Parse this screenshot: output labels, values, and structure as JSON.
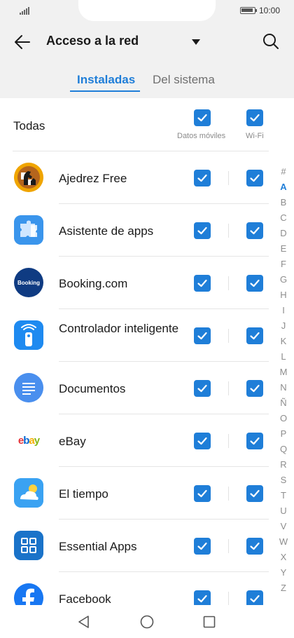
{
  "status": {
    "time": "10:00"
  },
  "header": {
    "title": "Acceso a la red",
    "tabs": [
      {
        "label": "Instaladas",
        "active": true
      },
      {
        "label": "Del sistema",
        "active": false
      }
    ]
  },
  "all_row": {
    "label": "Todas",
    "mobile_label": "Datos móviles",
    "wifi_label": "Wi-Fi",
    "mobile_checked": true,
    "wifi_checked": true
  },
  "apps": [
    {
      "name": "Ajedrez Free",
      "icon": "chess-icon",
      "mobile": true,
      "wifi": true
    },
    {
      "name": "Asistente de apps",
      "icon": "puzzle-icon",
      "mobile": true,
      "wifi": true
    },
    {
      "name": "Booking.com",
      "icon": "booking-logo-icon",
      "mobile": true,
      "wifi": true
    },
    {
      "name": "Controlador inteligente",
      "icon": "remote-control-icon",
      "mobile": true,
      "wifi": true
    },
    {
      "name": "Documentos",
      "icon": "document-icon",
      "mobile": true,
      "wifi": true
    },
    {
      "name": "eBay",
      "icon": "ebay-logo-icon",
      "mobile": true,
      "wifi": true
    },
    {
      "name": "El tiempo",
      "icon": "weather-icon",
      "mobile": true,
      "wifi": true
    },
    {
      "name": "Essential Apps",
      "icon": "grid-apps-icon",
      "mobile": true,
      "wifi": true
    },
    {
      "name": "Facebook",
      "icon": "facebook-logo-icon",
      "mobile": true,
      "wifi": true
    }
  ],
  "icon_text": {
    "booking": "Booking",
    "ebay": [
      "e",
      "b",
      "a",
      "y"
    ]
  },
  "alphabet": [
    "#",
    "A",
    "B",
    "C",
    "D",
    "E",
    "F",
    "G",
    "H",
    "I",
    "J",
    "K",
    "L",
    "M",
    "N",
    "Ñ",
    "O",
    "P",
    "Q",
    "R",
    "S",
    "T",
    "U",
    "V",
    "W",
    "X",
    "Y",
    "Z"
  ],
  "alphabet_active": "A",
  "colors": {
    "accent": "#1f7ed8",
    "header_bg": "#f1f1f1"
  }
}
